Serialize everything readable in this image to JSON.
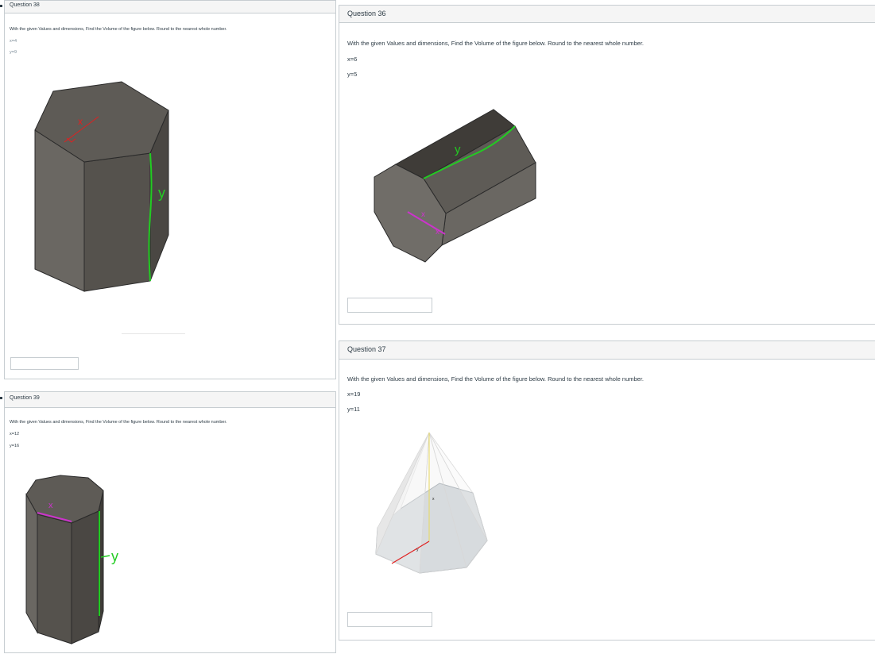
{
  "instruction": "With the given Values and dimensions, Find the Volume of the figure below. Round to the nearest whole number.",
  "questions": {
    "q38": {
      "title": "Question 38",
      "x": "x=4",
      "y": "y=9",
      "x_label": "x",
      "y_label": "y"
    },
    "q36": {
      "title": "Question 36",
      "x": "x=6",
      "y": "y=5",
      "x_label": "x",
      "y_label": "y"
    },
    "q37": {
      "title": "Question 37",
      "x": "x=19",
      "y": "y=11",
      "x_label": "x",
      "y_label": "y"
    },
    "q39": {
      "title": "Question 39",
      "x": "x=12",
      "y": "y=16",
      "x_label": "x",
      "y_label": "y"
    }
  },
  "colors": {
    "face_dark": "#55524d",
    "face_mid": "#6a6762",
    "face_top": "#5e5b56",
    "green": "#22cc22",
    "red": "#e02020",
    "magenta": "#cc33cc"
  }
}
